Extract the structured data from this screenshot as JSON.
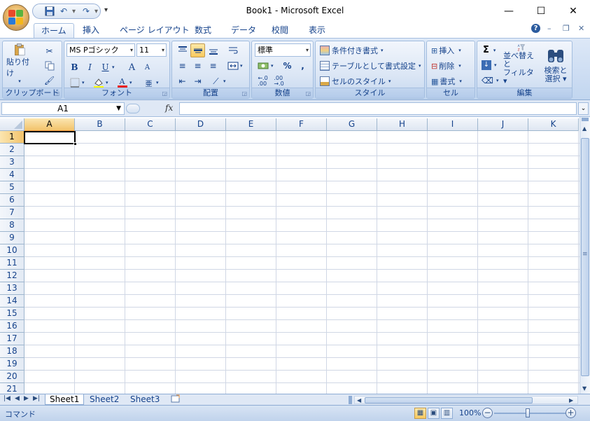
{
  "window": {
    "title": "Book1 - Microsoft Excel",
    "minimize": "—",
    "maximize": "☐",
    "close": "✕"
  },
  "quick_access": {
    "save_icon": "save-icon",
    "undo_icon": "undo-icon",
    "redo_icon": "redo-icon",
    "customize": "▾"
  },
  "tabs": [
    {
      "label": "ホーム",
      "active": true
    },
    {
      "label": "挿入"
    },
    {
      "label": "ページ レイアウト"
    },
    {
      "label": "数式"
    },
    {
      "label": "データ"
    },
    {
      "label": "校閲"
    },
    {
      "label": "表示"
    }
  ],
  "tab_right": {
    "help": "?",
    "min": "–",
    "restore": "❐",
    "close": "✕"
  },
  "ribbon": {
    "clipboard": {
      "paste_label": "貼り付け",
      "group_label": "クリップボード"
    },
    "font": {
      "font_name": "MS Pゴシック",
      "font_size": "11",
      "bold": "B",
      "italic": "I",
      "underline": "U",
      "grow": "A",
      "shrink": "A",
      "group_label": "フォント"
    },
    "alignment": {
      "group_label": "配置"
    },
    "number": {
      "format": "標準",
      "percent": "%",
      "comma": ",",
      "group_label": "数値"
    },
    "styles": {
      "conditional": "条件付き書式",
      "table": "テーブルとして書式設定",
      "cell_style": "セルのスタイル",
      "group_label": "スタイル"
    },
    "cells": {
      "insert": "挿入",
      "delete": "削除",
      "format": "書式",
      "group_label": "セル"
    },
    "editing": {
      "sum": "Σ",
      "sort_line1": "並べ替えと",
      "sort_line2": "フィルタ",
      "find_line1": "検索と",
      "find_line2": "選択",
      "group_label": "編集"
    }
  },
  "formula_bar": {
    "name_box": "A1",
    "fx": "fx",
    "formula": ""
  },
  "grid": {
    "columns": [
      "A",
      "B",
      "C",
      "D",
      "E",
      "F",
      "G",
      "H",
      "I",
      "J",
      "K"
    ],
    "rows": [
      "1",
      "2",
      "3",
      "4",
      "5",
      "6",
      "7",
      "8",
      "9",
      "10",
      "11",
      "12",
      "13",
      "14",
      "15",
      "16",
      "17",
      "18",
      "19",
      "20",
      "21"
    ],
    "selected_cell": "A1"
  },
  "sheets": [
    {
      "label": "Sheet1",
      "active": true
    },
    {
      "label": "Sheet2"
    },
    {
      "label": "Sheet3"
    }
  ],
  "status": {
    "mode": "コマンド",
    "zoom": "100%"
  },
  "colors": {
    "accent": "#15428b",
    "ribbon": "#cadbf2",
    "selection": "#f8c95d"
  }
}
